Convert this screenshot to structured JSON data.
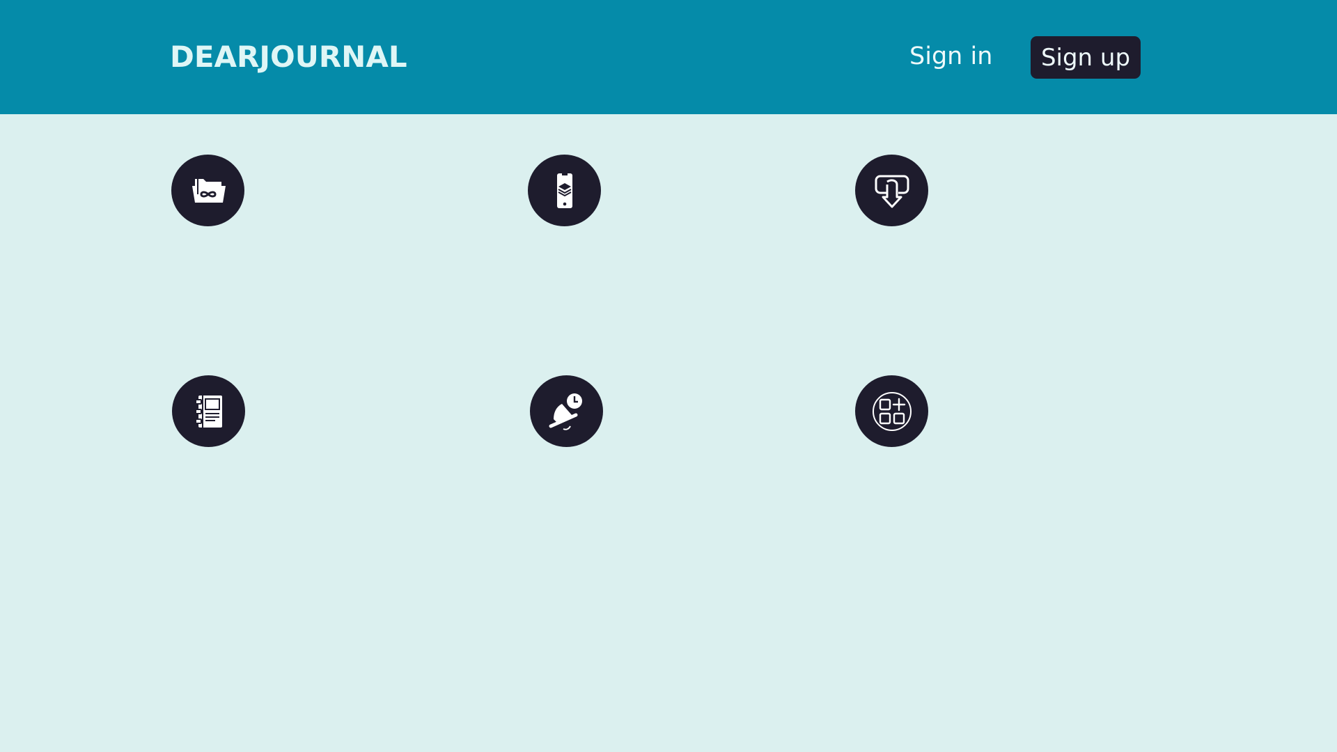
{
  "header": {
    "logo_text": "DEARJOURNAL",
    "sign_in_label": "Sign in",
    "sign_up_label": "Sign up"
  },
  "colors": {
    "header_bg": "#058ba9",
    "page_bg": "#dbf0ef",
    "dark": "#1e1c2d",
    "header_text": "#eef9fa"
  },
  "features": [
    {
      "icon": "folder-infinity-icon"
    },
    {
      "icon": "mobile-layers-icon"
    },
    {
      "icon": "chat-download-icon"
    },
    {
      "icon": "notebook-icon"
    },
    {
      "icon": "bell-clock-icon"
    },
    {
      "icon": "add-widget-icon"
    }
  ]
}
